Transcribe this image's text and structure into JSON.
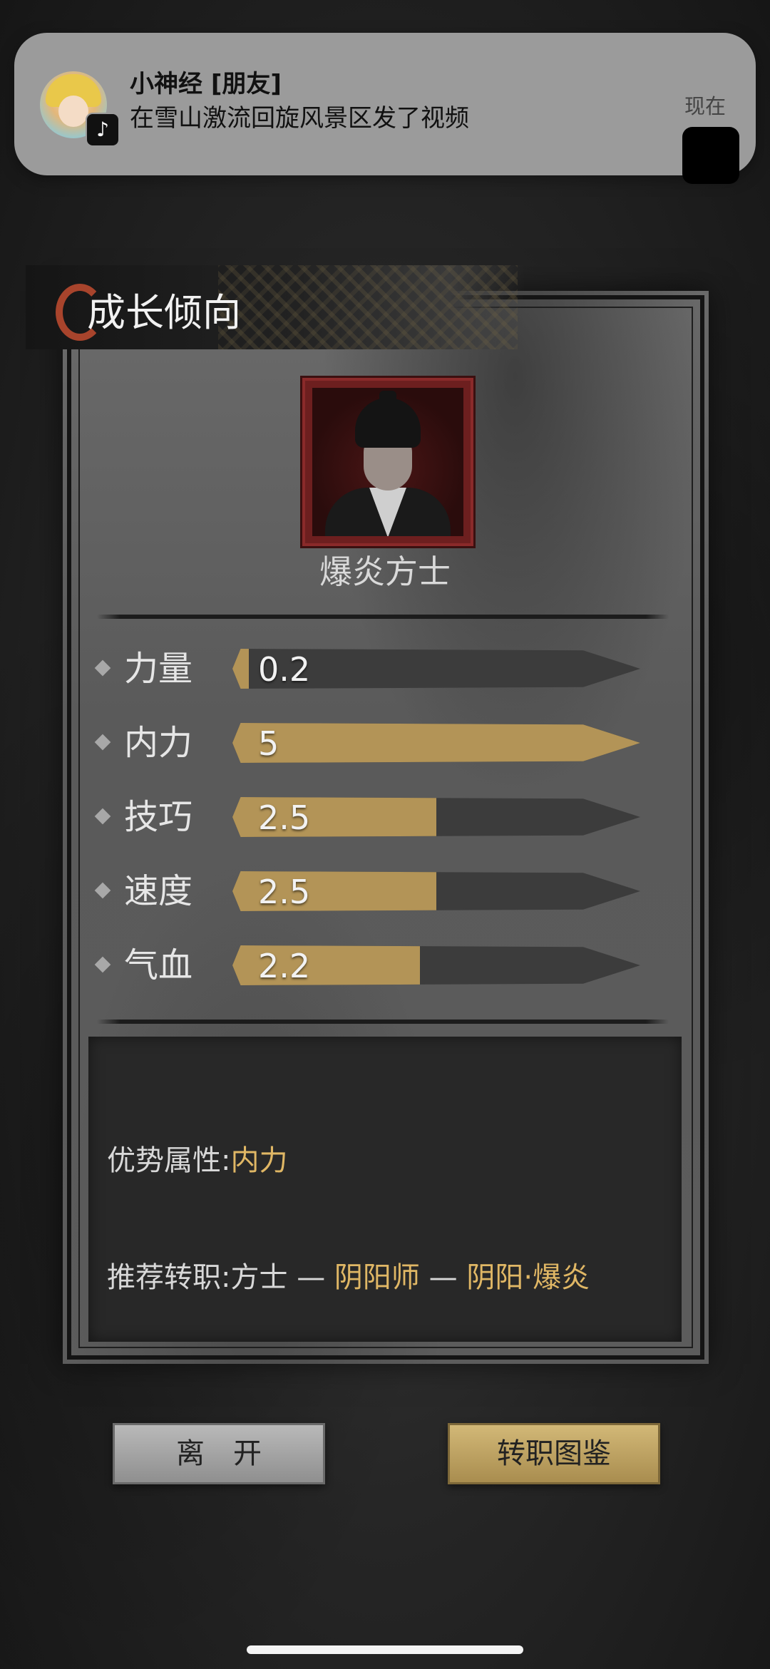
{
  "notification": {
    "title": "小神经 [朋友]",
    "body": "在雪山激流回旋风景区发了视频",
    "time": "现在",
    "app_icon": "tiktok-icon"
  },
  "panel": {
    "title": "成长倾向",
    "class_name": "爆炎方士"
  },
  "stats": [
    {
      "label": "力量",
      "value": "0.2",
      "fill": 0.04
    },
    {
      "label": "内力",
      "value": "5",
      "fill": 1.0
    },
    {
      "label": "技巧",
      "value": "2.5",
      "fill": 0.5
    },
    {
      "label": "速度",
      "value": "2.5",
      "fill": 0.5
    },
    {
      "label": "气血",
      "value": "2.2",
      "fill": 0.46
    }
  ],
  "info": {
    "advantage_label": "优势属性:",
    "advantage_value": "内力",
    "path_label": "推荐转职:",
    "path_start": "方士",
    "path_sep1": " — ",
    "path_mid": "阴阳师",
    "path_sep2": " — ",
    "path_end": "阴阳·爆炎"
  },
  "buttons": {
    "leave": "离　开",
    "atlas": "转职图鉴"
  },
  "colors": {
    "accent_gold": "#e0b765",
    "bar_gold": "#b39457",
    "bar_empty": "#3c3c3c"
  }
}
